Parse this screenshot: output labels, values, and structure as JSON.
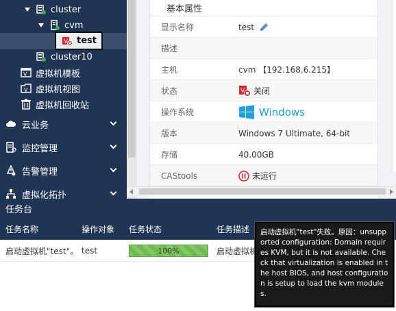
{
  "sidebar": {
    "tree": [
      {
        "label": "cluster",
        "icon": "cluster-icon"
      },
      {
        "label": "cvm",
        "icon": "host-icon"
      },
      {
        "label": "test",
        "icon": "vm-stopped-icon"
      },
      {
        "label": "cluster10",
        "icon": "cluster-icon"
      }
    ],
    "vm_links": [
      {
        "label": "虚拟机模板",
        "icon": "vm-template-icon"
      },
      {
        "label": "虚拟机视图",
        "icon": "vm-view-icon"
      },
      {
        "label": "虚拟机回收站",
        "icon": "recycle-bin-icon"
      }
    ],
    "menus": [
      {
        "label": "云业务",
        "icon": "cloud-icon"
      },
      {
        "label": "监控管理",
        "icon": "monitor-icon"
      },
      {
        "label": "告警管理",
        "icon": "alarm-icon"
      },
      {
        "label": "虚拟化拓扑",
        "icon": "topology-icon"
      }
    ]
  },
  "properties": {
    "title": "基本属性",
    "rows": [
      {
        "label": "显示名称",
        "value": "test"
      },
      {
        "label": "描述",
        "value": ""
      },
      {
        "label": "主机",
        "value": "cvm 【192.168.6.215】"
      },
      {
        "label": "状态",
        "value": "关闭"
      },
      {
        "label": "操作系统",
        "value": "Windows"
      },
      {
        "label": "版本",
        "value": "Windows 7 Ultimate, 64-bit"
      },
      {
        "label": "存储",
        "value": "40.00GB"
      },
      {
        "label": "CAStools",
        "value": "未运行"
      }
    ]
  },
  "taskbar": {
    "title": "任务台",
    "columns": [
      "任务名称",
      "操作对象",
      "任务状态",
      "任务描述"
    ],
    "rows": [
      {
        "name": "启动虚拟机\"test\"。",
        "target": "test",
        "progress_label": "100%",
        "progress": 1.0,
        "description": "启动虚拟机"
      }
    ]
  },
  "tooltip": {
    "text": "启动虚拟机\"test\"失败。原因：unsupported configuration: Domain requires KVM, but it is not available. Check that virtualization is enabled in the host BIOS, and host configuration is setup to load the kvm modules."
  },
  "colors": {
    "sidebar_bg": "#1f3553",
    "progress_green": "#6dbb4d",
    "windows_blue": "#1ba1e2",
    "stopped_red": "#d9232d"
  }
}
